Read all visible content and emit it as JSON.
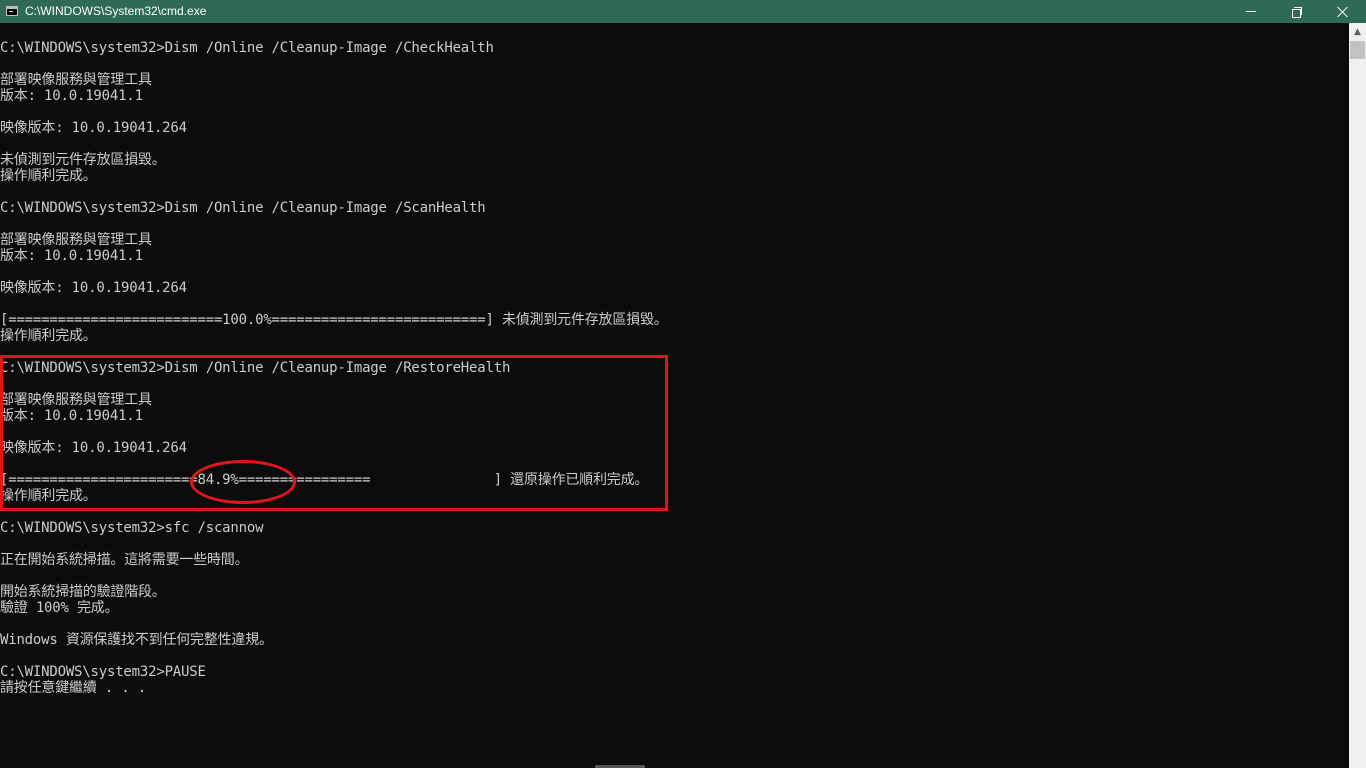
{
  "window": {
    "title": "C:\\WINDOWS\\System32\\cmd.exe",
    "icon": "cmd-icon",
    "controls": [
      "minimize-icon",
      "maximize-icon",
      "close-icon"
    ]
  },
  "console": {
    "lines": [
      "C:\\WINDOWS\\system32>Dism /Online /Cleanup-Image /CheckHealth",
      "",
      "部署映像服務與管理工具",
      "版本: 10.0.19041.1",
      "",
      "映像版本: 10.0.19041.264",
      "",
      "未偵測到元件存放區損毀。",
      "操作順利完成。",
      "",
      "C:\\WINDOWS\\system32>Dism /Online /Cleanup-Image /ScanHealth",
      "",
      "部署映像服務與管理工具",
      "版本: 10.0.19041.1",
      "",
      "映像版本: 10.0.19041.264",
      "",
      "[==========================100.0%==========================] 未偵測到元件存放區損毀。",
      "操作順利完成。",
      "",
      "C:\\WINDOWS\\system32>Dism /Online /Cleanup-Image /RestoreHealth",
      "",
      "部署映像服務與管理工具",
      "版本: 10.0.19041.1",
      "",
      "映像版本: 10.0.19041.264",
      "",
      "[=======================84.9%================               ] 還原操作已順利完成。",
      "操作順利完成。",
      "",
      "C:\\WINDOWS\\system32>sfc /scannow",
      "",
      "正在開始系統掃描。這將需要一些時間。",
      "",
      "開始系統掃描的驗證階段。",
      "驗證 100% 完成。",
      "",
      "Windows 資源保護找不到任何完整性違規。",
      "",
      "C:\\WINDOWS\\system32>PAUSE",
      "請按任意鍵繼續 . . ."
    ]
  },
  "annotations": {
    "highlight_color": "#e0161d",
    "box_label": "",
    "circled_value": "84.9%"
  },
  "colors": {
    "titlebar": "#2f6a57",
    "console_bg": "#0c0c0c",
    "console_text": "#cccccc"
  }
}
